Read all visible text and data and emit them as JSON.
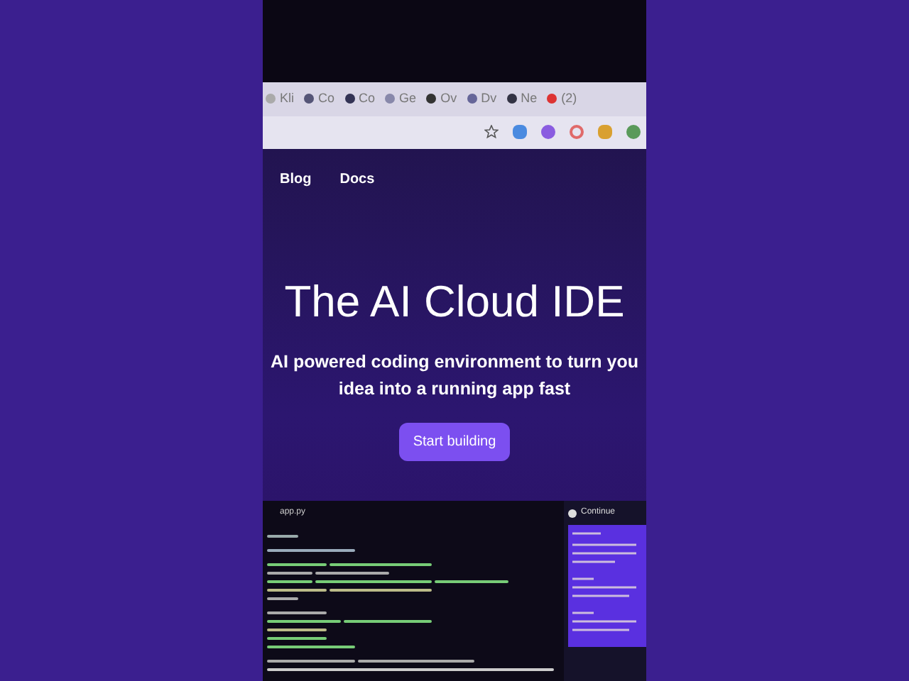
{
  "bookmarks": [
    {
      "label": "Kli"
    },
    {
      "label": "Co"
    },
    {
      "label": "Co"
    },
    {
      "label": "Ge"
    },
    {
      "label": "Ov"
    },
    {
      "label": "Dv"
    },
    {
      "label": "Ne"
    },
    {
      "label": "(2)"
    }
  ],
  "nav": {
    "links": [
      "Blog",
      "Docs"
    ]
  },
  "hero": {
    "title": "The AI Cloud IDE",
    "subtitle": "AI powered coding environment to turn you idea into a running app fast",
    "button": "Start building"
  },
  "editor": {
    "tab": "app.py"
  },
  "assistant": {
    "title": "Continue"
  }
}
